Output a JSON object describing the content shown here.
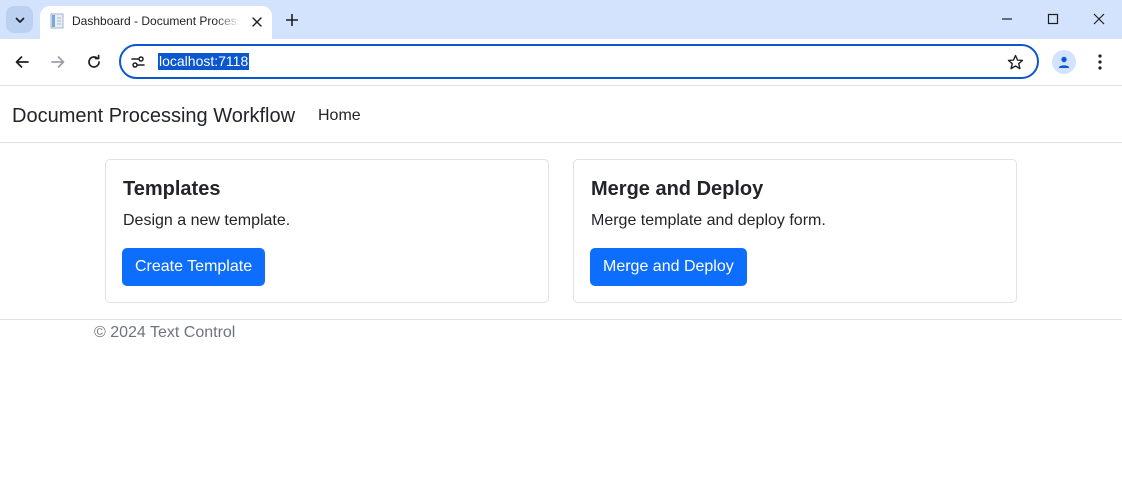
{
  "browser": {
    "tab_title": "Dashboard - Document Processing Workflow",
    "url": "localhost:7118"
  },
  "navbar": {
    "brand": "Document Processing Workflow",
    "links": [
      "Home"
    ]
  },
  "cards": [
    {
      "title": "Templates",
      "text": "Design a new template.",
      "button": "Create Template"
    },
    {
      "title": "Merge and Deploy",
      "text": "Merge template and deploy form.",
      "button": "Merge and Deploy"
    }
  ],
  "footer": {
    "text": "© 2024 Text Control"
  },
  "colors": {
    "primary_button": "#0d6efd",
    "omnibox_focus": "#0b57d0",
    "tabstrip": "#d3e3fd"
  },
  "icons": [
    "tab-search-icon",
    "document-favicon-icon",
    "close-icon",
    "plus-icon",
    "minimize-icon",
    "maximize-icon",
    "window-close-icon",
    "back-arrow-icon",
    "forward-arrow-icon",
    "reload-icon",
    "site-settings-icon",
    "star-icon",
    "profile-icon",
    "more-vert-icon"
  ]
}
